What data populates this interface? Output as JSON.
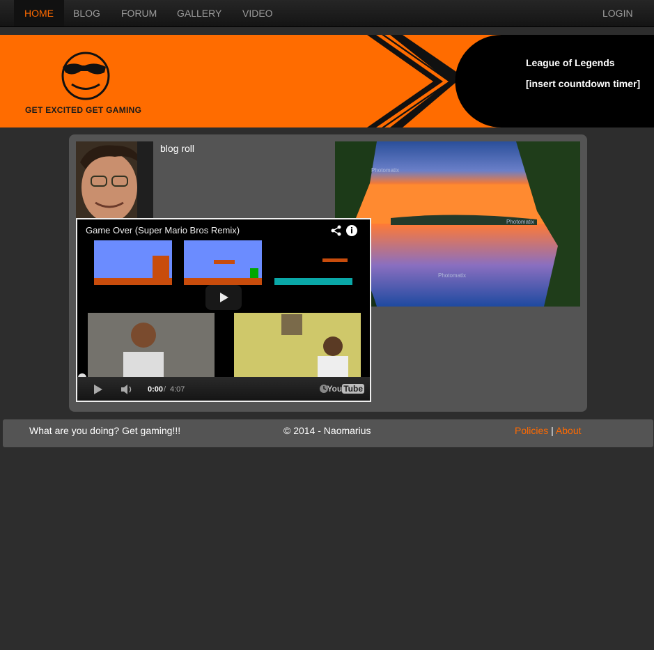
{
  "nav": {
    "items": [
      {
        "label": "HOME",
        "active": true
      },
      {
        "label": "BLOG"
      },
      {
        "label": "FORUM"
      },
      {
        "label": "GALLERY"
      },
      {
        "label": "VIDEO"
      }
    ],
    "login_label": "LOGIN"
  },
  "banner": {
    "tagline": "GET EXCITED GET GAMING",
    "game_title": "League of Legends",
    "timer_text": "[insert countdown timer]",
    "accent_color": "#ff6c00"
  },
  "content": {
    "blogroll_label": "blog roll",
    "photo_watermark": "Photomatix"
  },
  "video": {
    "title": "Game Over (Super Mario Bros Remix)",
    "current_time": "0:00",
    "separator": "/",
    "duration": "4:07",
    "brand_you": "You",
    "brand_tube": "Tube",
    "progress": 0
  },
  "footer": {
    "left_text": "What are you doing? Get gaming!!!",
    "copyright": "© 2014 - Naomarius",
    "policies_label": "Policies",
    "divider": "|",
    "about_label": "About",
    "link_color": "#ff6a00"
  }
}
